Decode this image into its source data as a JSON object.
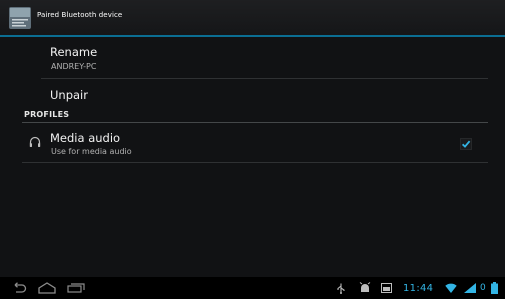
{
  "action_bar": {
    "title": "Paired Bluetooth device",
    "app_icon": "settings-icon"
  },
  "rename": {
    "label": "Rename",
    "value": "ANDREY-PC"
  },
  "unpair": {
    "label": "Unpair"
  },
  "profiles": {
    "header": "PROFILES",
    "items": [
      {
        "icon": "headphones-icon",
        "title": "Media audio",
        "summary": "Use for media audio",
        "checked": true
      }
    ]
  },
  "system_bar": {
    "nav_icons": [
      "back-icon",
      "home-icon",
      "recent-apps-icon"
    ],
    "status_icons": [
      "usb-icon",
      "debug-icon",
      "screenshot-icon",
      "wifi-icon",
      "signal-icon",
      "battery-icon"
    ],
    "time": "11:44",
    "signal_text": "0"
  },
  "colors": {
    "accent": "#33b5e5",
    "background": "#111214",
    "action_bar_rule": "#0b6e93"
  }
}
